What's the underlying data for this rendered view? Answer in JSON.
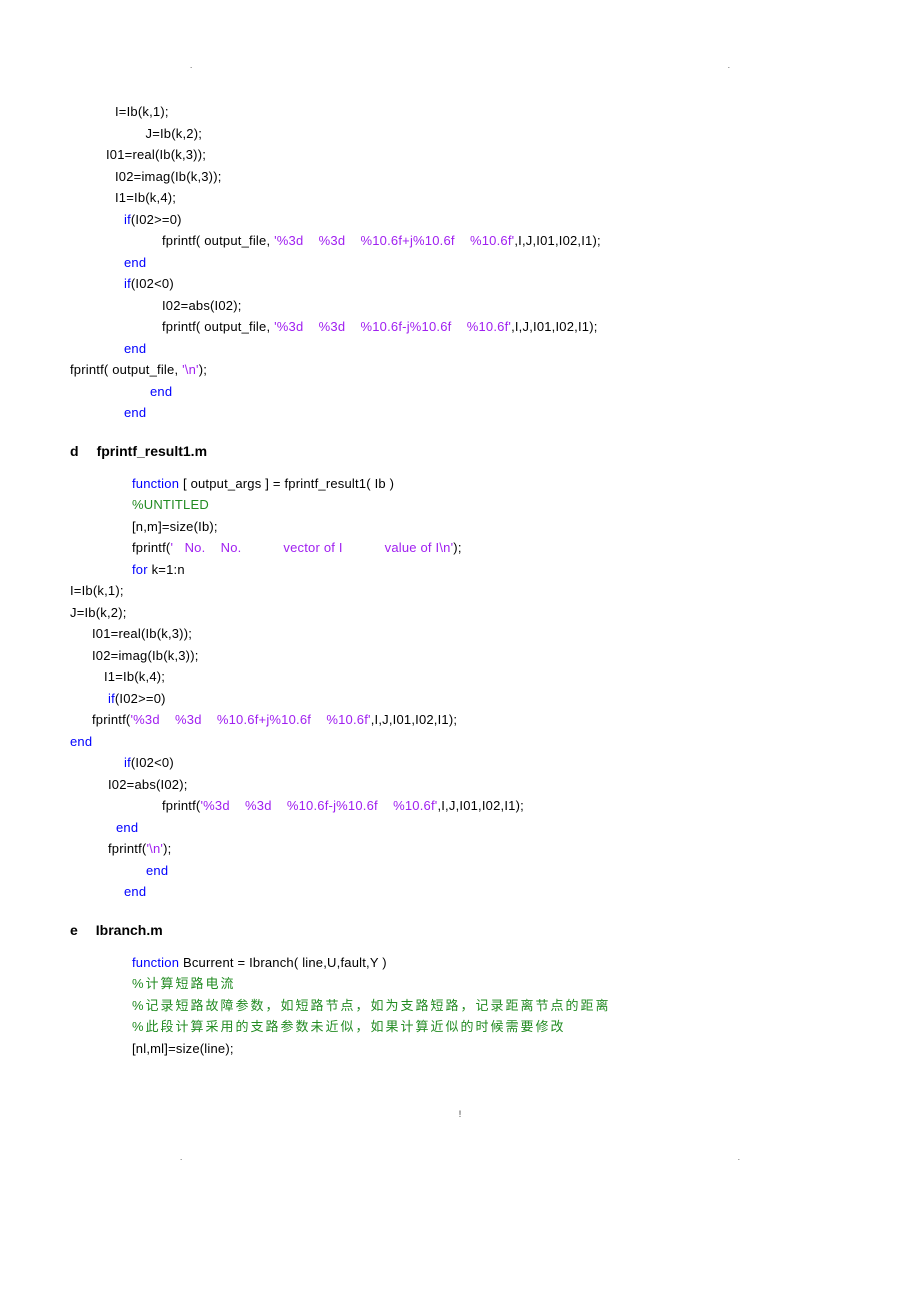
{
  "topDots": {
    "left": ".",
    "right": "."
  },
  "codeA": {
    "l1": "I=Ib(k,1);",
    "l2": "        J=Ib(k,2);",
    "l3": "I01=real(Ib(k,3));",
    "l4": "I02=imag(Ib(k,3));",
    "l5": "I1=Ib(k,4);",
    "if1": "if",
    "l6": "(I02>=0)",
    "l7a": "fprintf( output_file, ",
    "l7b": "'%3d    %3d    %10.6f+j%10.6f    %10.6f'",
    "l7c": ",I,J,I01,I02,I1);",
    "end1": "end",
    "if2": "if",
    "l8": "(I02<0)",
    "l9": "I02=abs(I02);",
    "l10a": "fprintf( output_file, ",
    "l10b": "'%3d    %3d    %10.6f-j%10.6f    %10.6f'",
    "l10c": ",I,J,I01,I02,I1);",
    "end2": "end",
    "l11a": "fprintf( output_file, ",
    "l11b": "'\\n'",
    "l11c": ");",
    "end3": "end",
    "end4": "end"
  },
  "headingD": {
    "label": "d",
    "name": "fprintf_result1.m"
  },
  "codeD": {
    "func": "function",
    "l1": " [ output_args ] = fprintf_result1( Ib )",
    "cmt1": "%UNTITLED",
    "l2": "[n,m]=size(Ib);",
    "l3a": "fprintf(",
    "l3b": "'   No.    No.           vector of I           value of I\\n'",
    "l3c": ");",
    "for": "for",
    "l4": " k=1:n",
    "l5": "I=Ib(k,1);",
    "l6": "J=Ib(k,2);",
    "l7": "I01=real(Ib(k,3));",
    "l8": "I02=imag(Ib(k,3));",
    "l9": "I1=Ib(k,4);",
    "if1": "if",
    "l10": "(I02>=0)",
    "l11a": "fprintf(",
    "l11b": "'%3d    %3d    %10.6f+j%10.6f    %10.6f'",
    "l11c": ",I,J,I01,I02,I1);",
    "end1": "end",
    "if2": "if",
    "l12": "(I02<0)",
    "l13": "I02=abs(I02);",
    "l14a": "fprintf(",
    "l14b": "'%3d    %3d    %10.6f-j%10.6f    %10.6f'",
    "l14c": ",I,J,I01,I02,I1);",
    "end2": "end",
    "l15a": "fprintf(",
    "l15b": "'\\n'",
    "l15c": ");",
    "end3": "end",
    "end4": "end"
  },
  "headingE": {
    "label": "e",
    "name": "Ibranch.m"
  },
  "codeE": {
    "func": "function",
    "l1": " Bcurrent = Ibranch( line,U,fault,Y )",
    "cmt1": "%计算短路电流",
    "cmt2": "%记录短路故障参数，如短路节点，如为支路短路，记录距离节点的距离",
    "cmt3": "%此段计算采用的支路参数未近似，如果计算近似的时候需要修改",
    "l2": "[nl,ml]=size(line);"
  },
  "footer": "!",
  "botDots": {
    "left": ".",
    "right": "."
  }
}
